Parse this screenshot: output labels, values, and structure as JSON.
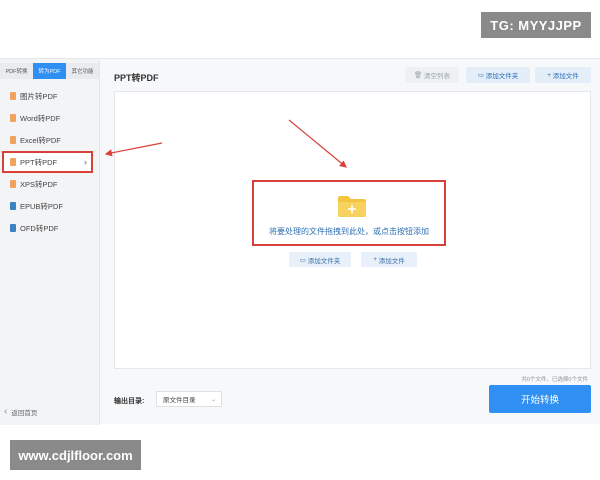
{
  "watermarks": {
    "top": "TG: MYYJJPP",
    "bottom": "www.cdjlfloor.com"
  },
  "sidebar": {
    "tabs": [
      {
        "label": "PDF转换",
        "active": false
      },
      {
        "label": "转为PDF",
        "active": true
      },
      {
        "label": "其它功能",
        "active": false
      }
    ],
    "items": [
      {
        "label": "图片转PDF",
        "icon": "image-file-icon",
        "color": "#f0a35c"
      },
      {
        "label": "Word转PDF",
        "icon": "word-file-icon",
        "color": "#f0a35c"
      },
      {
        "label": "Excel转PDF",
        "icon": "excel-file-icon",
        "color": "#f0a35c"
      },
      {
        "label": "PPT转PDF",
        "icon": "ppt-file-icon",
        "color": "#f0a35c",
        "selected": true
      },
      {
        "label": "XPS转PDF",
        "icon": "xps-file-icon",
        "color": "#f0a35c"
      },
      {
        "label": "EPUB转PDF",
        "icon": "epub-file-icon",
        "color": "#3b82c4"
      },
      {
        "label": "OFD转PDF",
        "icon": "ofd-file-icon",
        "color": "#3b82c4"
      }
    ],
    "back": "返回首页"
  },
  "main": {
    "title": "PPT转PDF",
    "toolbar": {
      "clear": "清空列表",
      "add_folder": "添加文件夹",
      "add_file": "添加文件"
    },
    "drop": {
      "hint": "将要处理的文件拖拽到此处，或点击按钮添加",
      "add_folder": "添加文件夹",
      "add_file": "添加文件"
    },
    "status": "共0个文件，已选择0个文件",
    "output": {
      "label": "输出目录:",
      "value": "原文件目录"
    },
    "start": "开始转换"
  },
  "colors": {
    "accent": "#2f8ff2",
    "highlight": "#d9403a",
    "folder": "#f5c542"
  }
}
